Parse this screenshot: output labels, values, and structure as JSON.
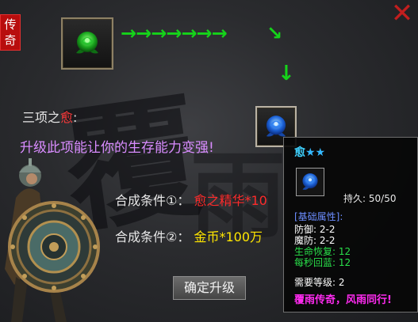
{
  "badge": {
    "text": "传奇"
  },
  "close": {
    "glyph": "✕"
  },
  "flow": {
    "arrows": "→→→→→→→",
    "diag": "↘",
    "down": "↓"
  },
  "skill": {
    "prefix": "三项之",
    "name": "愈",
    "suffix": ":",
    "description": "升级此项能让你的生存能力变强!"
  },
  "conditions": [
    {
      "label": "合成条件①：",
      "value": "愈之精华*10"
    },
    {
      "label": "合成条件②：",
      "value": "金币*100万"
    }
  ],
  "upgrade_button": {
    "label": "确定升级"
  },
  "tooltip": {
    "name": "愈",
    "stars": "★★",
    "durability_label": "持久:",
    "durability_value": "50/50",
    "section": "[基础属性]:",
    "defense": "防御: 2-2",
    "magic_defense": "魔防: 2-2",
    "hp_regen": "生命恢复: 12",
    "mp_regen": "每秒回蓝: 12",
    "required_level_label": "需要等级:",
    "required_level_value": "2",
    "slogan": "覆雨传奇，风雨同行!"
  },
  "colors": {
    "arrow": "#15d31a",
    "skill_name": "#ff3a3a",
    "description": "#d98cff",
    "condition1_value": "#ff2b2b",
    "condition2_value": "#ffe600",
    "tooltip_title": "#3fd2ff",
    "tooltip_green": "#29e04a",
    "slogan": "#ff2bf0"
  },
  "icons": {
    "source_item": "green-rose-icon",
    "target_item": "blue-rose-icon",
    "close": "close-icon",
    "warrior": "warrior-figure"
  }
}
